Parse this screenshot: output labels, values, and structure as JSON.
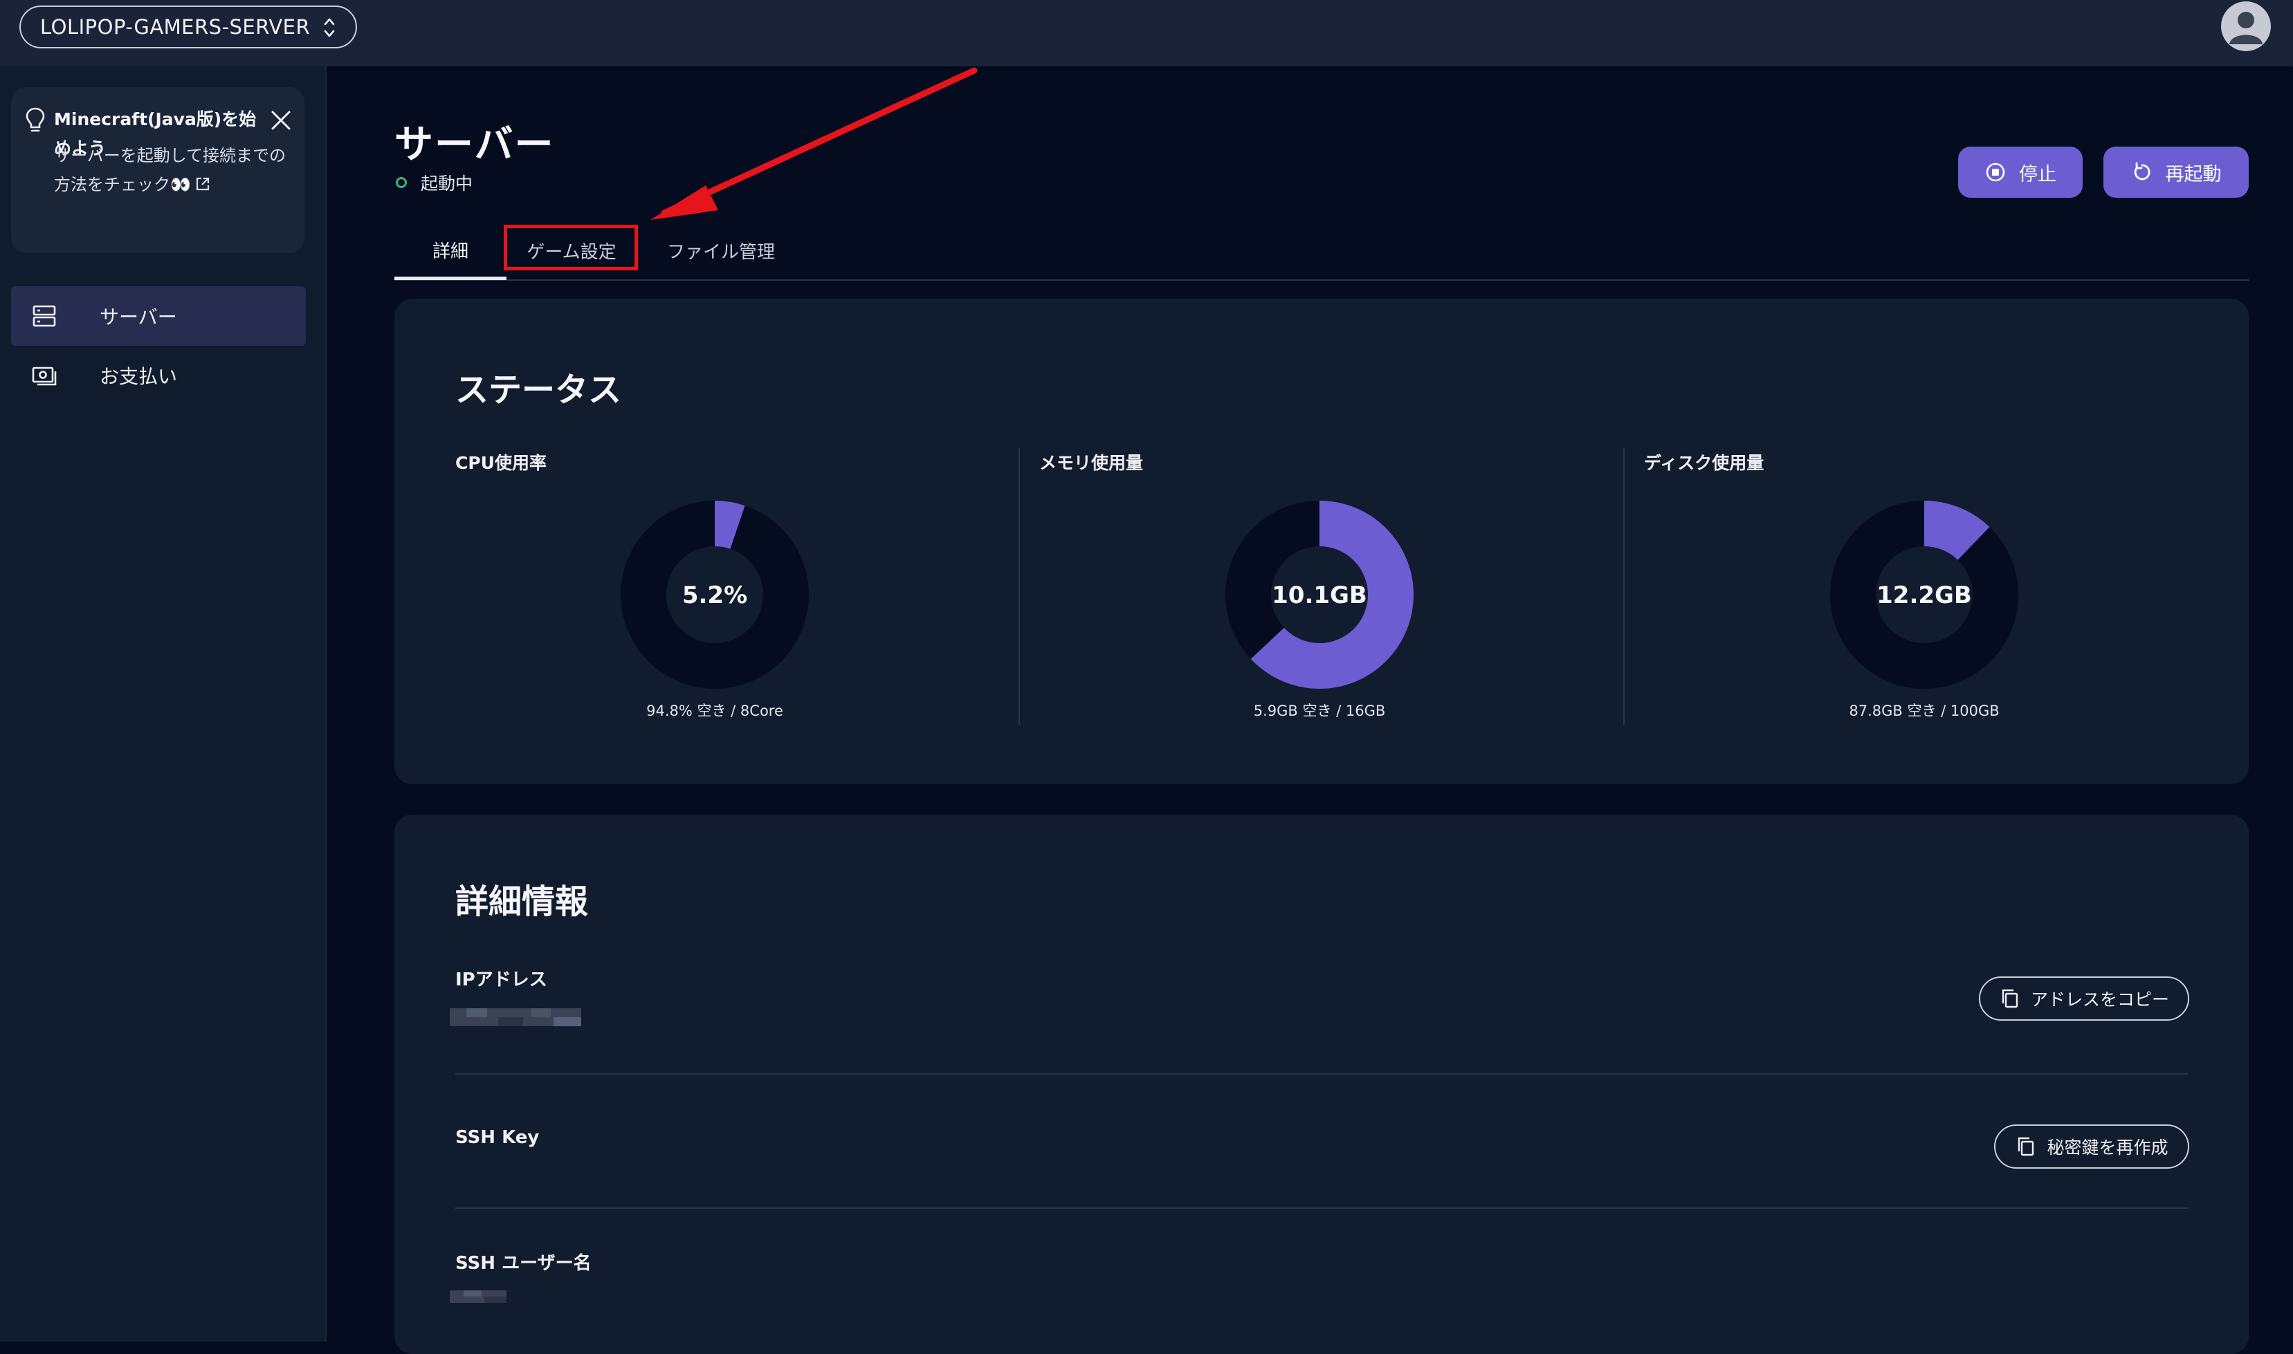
{
  "header": {
    "server_name": "LOLIPOP-GAMERS-SERVER",
    "icons": [
      "chevron-up-down-icon",
      "user-avatar-icon"
    ]
  },
  "sidebar": {
    "tip": {
      "title": "Minecraft(Java版)を始めよう",
      "body": "サーバーを起動して接続までの方法をチェック👀",
      "icons": [
        "lightbulb-icon",
        "close-icon",
        "external-link-icon"
      ]
    },
    "items": [
      {
        "label": "サーバー",
        "icon": "server-icon",
        "active": true
      },
      {
        "label": "お支払い",
        "icon": "payment-icon",
        "active": false
      }
    ]
  },
  "main": {
    "title": "サーバー",
    "status": "起動中",
    "status_color": "#36b37e",
    "actions": {
      "stop": "停止",
      "restart": "再起動"
    },
    "tabs": [
      {
        "label": "詳細",
        "active": true
      },
      {
        "label": "ゲーム設定",
        "active": false,
        "highlighted": true
      },
      {
        "label": "ファイル管理",
        "active": false
      }
    ],
    "status_card": {
      "title": "ステータス",
      "metrics": [
        {
          "label": "CPU使用率",
          "value": "5.2%",
          "caption": "94.8% 空き / 8Core",
          "fraction": 0.052
        },
        {
          "label": "メモリ使用量",
          "value": "10.1GB",
          "caption": "5.9GB 空き / 16GB",
          "fraction": 0.63
        },
        {
          "label": "ディスク使用量",
          "value": "12.2GB",
          "caption": "87.8GB 空き / 100GB",
          "fraction": 0.122
        }
      ]
    },
    "details_card": {
      "title": "詳細情報",
      "ip_label": "IPアドレス",
      "copy_button": "アドレスをコピー",
      "ssh_key_label": "SSH Key",
      "regen_button": "秘密鍵を再作成",
      "ssh_user_label": "SSH ユーザー名"
    }
  },
  "colors": {
    "accent": "#6c5dd3",
    "donut_track": "#050c1f",
    "annotation": "#e8141c"
  }
}
